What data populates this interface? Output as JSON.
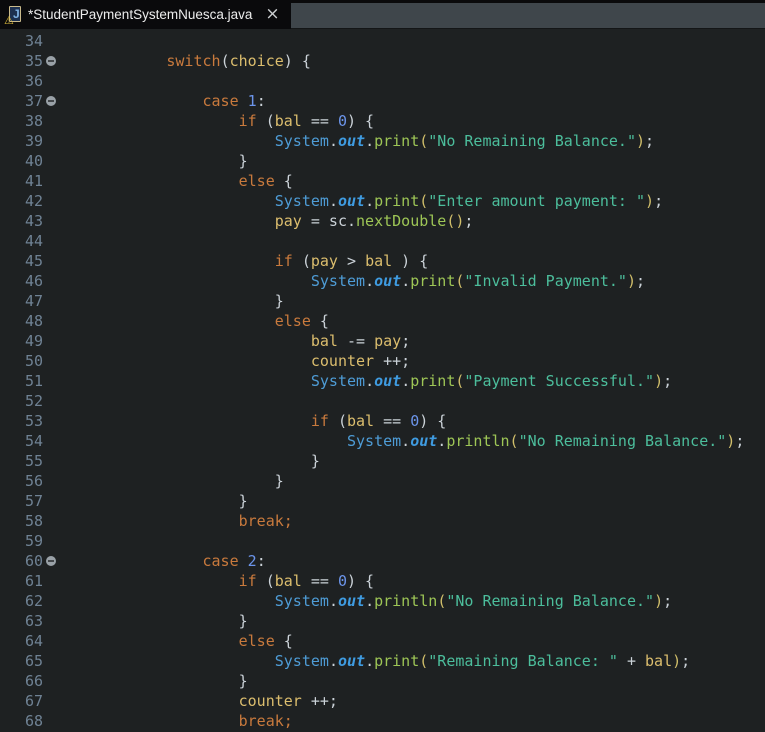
{
  "tab": {
    "title": "*StudentPaymentSystemNuesca.java",
    "icon_letter": "J",
    "warning_glyph": "⚠",
    "close_glyph": "×"
  },
  "colors": {
    "editor_background": "#1E2122",
    "tabbar_background": "#3F464B",
    "active_tab_background": "#0A0A0C",
    "line_number": "#6F8294",
    "keyword": "#C97A3D",
    "variable": "#DCBE6E",
    "plain": "#CBD2D8",
    "number": "#6C95EB",
    "class_name": "#4E9CD6",
    "field": "#3F9BE0",
    "method": "#9EC656",
    "string": "#4CBE9C",
    "call_paren": "#D0BE6A"
  },
  "editor": {
    "lines": [
      {
        "num": 34,
        "fold": false,
        "segs": []
      },
      {
        "num": 35,
        "fold": true,
        "segs": [
          [
            "p",
            "            "
          ],
          [
            "k",
            "switch"
          ],
          [
            "p",
            "("
          ],
          [
            "v",
            "choice"
          ],
          [
            "p",
            ") {"
          ]
        ]
      },
      {
        "num": 36,
        "fold": false,
        "segs": []
      },
      {
        "num": 37,
        "fold": true,
        "segs": [
          [
            "p",
            "                "
          ],
          [
            "k",
            "case "
          ],
          [
            "n",
            "1"
          ],
          [
            "p",
            ":"
          ]
        ]
      },
      {
        "num": 38,
        "fold": false,
        "segs": [
          [
            "p",
            "                    "
          ],
          [
            "k",
            "if "
          ],
          [
            "p",
            "("
          ],
          [
            "v",
            "bal"
          ],
          [
            "p",
            " == "
          ],
          [
            "n",
            "0"
          ],
          [
            "p",
            ") {"
          ]
        ]
      },
      {
        "num": 39,
        "fold": false,
        "segs": [
          [
            "p",
            "                        "
          ],
          [
            "c",
            "System"
          ],
          [
            "p",
            "."
          ],
          [
            "f",
            "out"
          ],
          [
            "p",
            "."
          ],
          [
            "m",
            "print"
          ],
          [
            "g",
            "("
          ],
          [
            "s",
            "\"No Remaining Balance.\""
          ],
          [
            "g",
            ")"
          ],
          [
            "p",
            ";"
          ]
        ]
      },
      {
        "num": 40,
        "fold": false,
        "segs": [
          [
            "p",
            "                    }"
          ]
        ]
      },
      {
        "num": 41,
        "fold": false,
        "segs": [
          [
            "p",
            "                    "
          ],
          [
            "k",
            "else"
          ],
          [
            "p",
            " {"
          ]
        ]
      },
      {
        "num": 42,
        "fold": false,
        "segs": [
          [
            "p",
            "                        "
          ],
          [
            "c",
            "System"
          ],
          [
            "p",
            "."
          ],
          [
            "f",
            "out"
          ],
          [
            "p",
            "."
          ],
          [
            "m",
            "print"
          ],
          [
            "g",
            "("
          ],
          [
            "s",
            "\"Enter amount payment: \""
          ],
          [
            "g",
            ")"
          ],
          [
            "p",
            ";"
          ]
        ]
      },
      {
        "num": 43,
        "fold": false,
        "segs": [
          [
            "p",
            "                        "
          ],
          [
            "v",
            "pay"
          ],
          [
            "p",
            " = sc."
          ],
          [
            "m",
            "nextDouble"
          ],
          [
            "g",
            "()"
          ],
          [
            "p",
            ";"
          ]
        ]
      },
      {
        "num": 44,
        "fold": false,
        "segs": []
      },
      {
        "num": 45,
        "fold": false,
        "segs": [
          [
            "p",
            "                        "
          ],
          [
            "k",
            "if "
          ],
          [
            "p",
            "("
          ],
          [
            "v",
            "pay"
          ],
          [
            "p",
            " > "
          ],
          [
            "v",
            "bal"
          ],
          [
            "p",
            " ) {"
          ]
        ]
      },
      {
        "num": 46,
        "fold": false,
        "segs": [
          [
            "p",
            "                            "
          ],
          [
            "c",
            "System"
          ],
          [
            "p",
            "."
          ],
          [
            "f",
            "out"
          ],
          [
            "p",
            "."
          ],
          [
            "m",
            "print"
          ],
          [
            "g",
            "("
          ],
          [
            "s",
            "\"Invalid Payment.\""
          ],
          [
            "g",
            ")"
          ],
          [
            "p",
            ";"
          ]
        ]
      },
      {
        "num": 47,
        "fold": false,
        "segs": [
          [
            "p",
            "                        }"
          ]
        ]
      },
      {
        "num": 48,
        "fold": false,
        "segs": [
          [
            "p",
            "                        "
          ],
          [
            "k",
            "else"
          ],
          [
            "p",
            " {"
          ]
        ]
      },
      {
        "num": 49,
        "fold": false,
        "segs": [
          [
            "p",
            "                            "
          ],
          [
            "v",
            "bal"
          ],
          [
            "p",
            " -= "
          ],
          [
            "v",
            "pay"
          ],
          [
            "p",
            ";"
          ]
        ]
      },
      {
        "num": 50,
        "fold": false,
        "segs": [
          [
            "p",
            "                            "
          ],
          [
            "v",
            "counter"
          ],
          [
            "p",
            " ++;"
          ]
        ]
      },
      {
        "num": 51,
        "fold": false,
        "segs": [
          [
            "p",
            "                            "
          ],
          [
            "c",
            "System"
          ],
          [
            "p",
            "."
          ],
          [
            "f",
            "out"
          ],
          [
            "p",
            "."
          ],
          [
            "m",
            "print"
          ],
          [
            "g",
            "("
          ],
          [
            "s",
            "\"Payment Successful.\""
          ],
          [
            "g",
            ")"
          ],
          [
            "p",
            ";"
          ]
        ]
      },
      {
        "num": 52,
        "fold": false,
        "segs": []
      },
      {
        "num": 53,
        "fold": false,
        "segs": [
          [
            "p",
            "                            "
          ],
          [
            "k",
            "if "
          ],
          [
            "p",
            "("
          ],
          [
            "v",
            "bal"
          ],
          [
            "p",
            " == "
          ],
          [
            "n",
            "0"
          ],
          [
            "p",
            ") {"
          ]
        ]
      },
      {
        "num": 54,
        "fold": false,
        "segs": [
          [
            "p",
            "                                "
          ],
          [
            "c",
            "System"
          ],
          [
            "p",
            "."
          ],
          [
            "f",
            "out"
          ],
          [
            "p",
            "."
          ],
          [
            "m",
            "println"
          ],
          [
            "g",
            "("
          ],
          [
            "s",
            "\"No Remaining Balance.\""
          ],
          [
            "g",
            ")"
          ],
          [
            "p",
            ";"
          ]
        ]
      },
      {
        "num": 55,
        "fold": false,
        "segs": [
          [
            "p",
            "                            }"
          ]
        ]
      },
      {
        "num": 56,
        "fold": false,
        "segs": [
          [
            "p",
            "                        }"
          ]
        ]
      },
      {
        "num": 57,
        "fold": false,
        "segs": [
          [
            "p",
            "                    }"
          ]
        ]
      },
      {
        "num": 58,
        "fold": false,
        "segs": [
          [
            "p",
            "                    "
          ],
          [
            "k",
            "break;"
          ]
        ]
      },
      {
        "num": 59,
        "fold": false,
        "segs": []
      },
      {
        "num": 60,
        "fold": true,
        "segs": [
          [
            "p",
            "                "
          ],
          [
            "k",
            "case "
          ],
          [
            "n",
            "2"
          ],
          [
            "p",
            ":"
          ]
        ]
      },
      {
        "num": 61,
        "fold": false,
        "segs": [
          [
            "p",
            "                    "
          ],
          [
            "k",
            "if "
          ],
          [
            "p",
            "("
          ],
          [
            "v",
            "bal"
          ],
          [
            "p",
            " == "
          ],
          [
            "n",
            "0"
          ],
          [
            "p",
            ") {"
          ]
        ]
      },
      {
        "num": 62,
        "fold": false,
        "segs": [
          [
            "p",
            "                        "
          ],
          [
            "c",
            "System"
          ],
          [
            "p",
            "."
          ],
          [
            "f",
            "out"
          ],
          [
            "p",
            "."
          ],
          [
            "m",
            "println"
          ],
          [
            "g",
            "("
          ],
          [
            "s",
            "\"No Remaining Balance.\""
          ],
          [
            "g",
            ")"
          ],
          [
            "p",
            ";"
          ]
        ]
      },
      {
        "num": 63,
        "fold": false,
        "segs": [
          [
            "p",
            "                    }"
          ]
        ]
      },
      {
        "num": 64,
        "fold": false,
        "segs": [
          [
            "p",
            "                    "
          ],
          [
            "k",
            "else"
          ],
          [
            "p",
            " {"
          ]
        ]
      },
      {
        "num": 65,
        "fold": false,
        "segs": [
          [
            "p",
            "                        "
          ],
          [
            "c",
            "System"
          ],
          [
            "p",
            "."
          ],
          [
            "f",
            "out"
          ],
          [
            "p",
            "."
          ],
          [
            "m",
            "print"
          ],
          [
            "g",
            "("
          ],
          [
            "s",
            "\"Remaining Balance: \""
          ],
          [
            "p",
            " + "
          ],
          [
            "v",
            "bal"
          ],
          [
            "g",
            ")"
          ],
          [
            "p",
            ";"
          ]
        ]
      },
      {
        "num": 66,
        "fold": false,
        "segs": [
          [
            "p",
            "                    }"
          ]
        ]
      },
      {
        "num": 67,
        "fold": false,
        "segs": [
          [
            "p",
            "                    "
          ],
          [
            "v",
            "counter"
          ],
          [
            "p",
            " ++;"
          ]
        ]
      },
      {
        "num": 68,
        "fold": false,
        "segs": [
          [
            "p",
            "                    "
          ],
          [
            "k",
            "break;"
          ]
        ]
      }
    ]
  }
}
